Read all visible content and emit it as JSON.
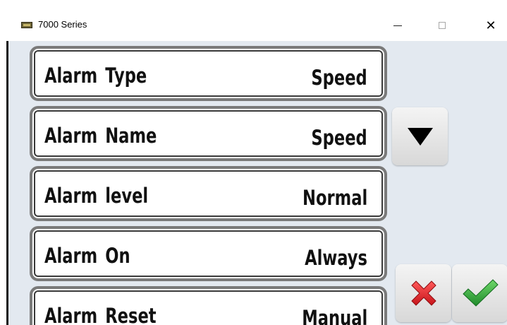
{
  "window": {
    "title": "7000 Series",
    "app_icon": "display-device-icon",
    "controls": {
      "minimize_icon": "minimize-icon",
      "maximize_icon": "maximize-icon",
      "close_icon": "close-icon",
      "close_glyph": "✕"
    }
  },
  "settings": [
    {
      "label": "Alarm  Type",
      "value": "Speed"
    },
    {
      "label": "Alarm  Name",
      "value": "Speed"
    },
    {
      "label": "Alarm  level",
      "value": "Normal"
    },
    {
      "label": "Alarm  On",
      "value": "Always"
    },
    {
      "label": "Alarm  Reset",
      "value": "Manual"
    }
  ],
  "buttons": {
    "scroll_down_icon": "triangle-down-icon",
    "cancel_icon": "red-x-icon",
    "confirm_icon": "green-check-icon"
  },
  "colors": {
    "background": "#e3e9f0",
    "cancel": "#e0262b",
    "confirm": "#2ea43a",
    "arrow": "#000000"
  }
}
